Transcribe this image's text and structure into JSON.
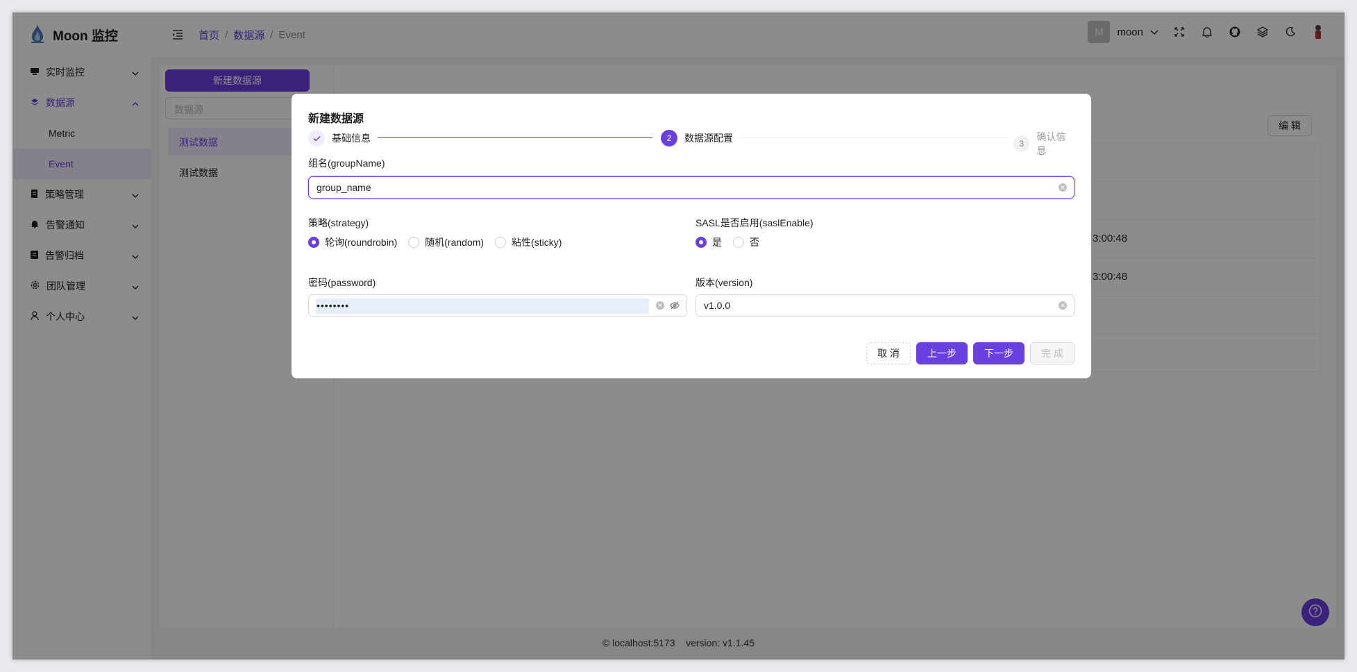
{
  "app": {
    "name": "Moon 监控"
  },
  "breadcrumb": [
    "首页",
    "数据源",
    "Event"
  ],
  "user": {
    "avatar_letter": "M",
    "name": "moon"
  },
  "sidebar": {
    "items": [
      {
        "label": "实时监控",
        "icon": "monitor-icon"
      },
      {
        "label": "数据源",
        "icon": "layers-icon",
        "active": true,
        "children": [
          "Metric",
          "Event"
        ]
      },
      {
        "label": "策略管理",
        "icon": "document-icon"
      },
      {
        "label": "告警通知",
        "icon": "bell-icon"
      },
      {
        "label": "告警归档",
        "icon": "archive-icon"
      },
      {
        "label": "团队管理",
        "icon": "gear-icon"
      },
      {
        "label": "个人中心",
        "icon": "user-icon"
      }
    ]
  },
  "datasource_panel": {
    "new_button": "新建数据源",
    "search_placeholder": "数据源",
    "items": [
      "测试数据",
      "测试数据"
    ]
  },
  "detail": {
    "edit_button": "编 辑",
    "times": [
      "3:00:48",
      "3:00:48"
    ]
  },
  "footer": {
    "host": "localhost:5173",
    "version": "version: v1.1.45"
  },
  "modal": {
    "title": "新建数据源",
    "steps": [
      {
        "label": "基础信息",
        "status": "done"
      },
      {
        "number": "2",
        "label": "数据源配置",
        "status": "current"
      },
      {
        "number": "3",
        "label": "确认信息",
        "status": "wait"
      }
    ],
    "group_name": {
      "label": "组名(groupName)",
      "value": "group_name"
    },
    "strategy": {
      "label": "策略(strategy)",
      "options": [
        "轮询(roundrobin)",
        "随机(random)",
        "粘性(sticky)"
      ],
      "selected": "轮询(roundrobin)"
    },
    "sasl": {
      "label": "SASL是否启用(saslEnable)",
      "options": [
        "是",
        "否"
      ],
      "selected": "是"
    },
    "password": {
      "label": "密码(password)",
      "value": "••••••••"
    },
    "version": {
      "label": "版本(version)",
      "value": "v1.0.0"
    },
    "buttons": {
      "cancel": "取 消",
      "prev": "上一步",
      "next": "下一步",
      "finish": "完 成"
    }
  },
  "colors": {
    "accent": "#6a3fe0",
    "accent_light": "#f1ecfd"
  }
}
